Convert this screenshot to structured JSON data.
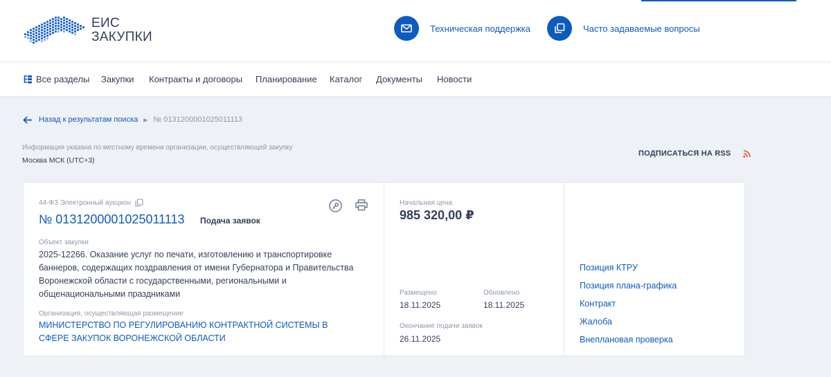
{
  "header": {
    "logo_line1": "ЕИС",
    "logo_line2": "ЗАКУПКИ",
    "support_label": "Техническая поддержка",
    "faq_label": "Часто задаваемые вопросы",
    "accent_color": "#0d5bbf"
  },
  "nav": {
    "items": [
      {
        "label": "Все разделы",
        "icon": "sections-icon"
      },
      {
        "label": "Закупки"
      },
      {
        "label": "Контракты и договоры"
      },
      {
        "label": "Планирование"
      },
      {
        "label": "Каталог"
      },
      {
        "label": "Документы"
      },
      {
        "label": "Новости"
      }
    ]
  },
  "breadcrumb": {
    "back_label": "Назад к результатам поиска",
    "current": "№ 0131200001025011113"
  },
  "timezone": {
    "note": "Информация указана по местному времени организации, осуществляющей закупку",
    "value": "Москва МСК (UTC+3)"
  },
  "rss": {
    "label": "ПОДПИСАТЬСЯ НА RSS",
    "icon": "rss-icon",
    "icon_color": "#e8542e"
  },
  "purchase": {
    "law_type": "44-ФЗ Электронный аукцион",
    "number": "№ 0131200001025011113",
    "status": "Подача заявок",
    "object_label": "Объект закупки",
    "object_text": "2025-12266. Оказание услуг по печати, изготовлению и транспортировке баннеров, содержащих поздравления от имени Губернатора и Правительства Воронежской области с государственными, региональными и общенациональными праздниками",
    "org_label": "Организация, осуществляющая размещение",
    "org_name": "МИНИСТЕРСТВО ПО РЕГУЛИРОВАНИЮ КОНТРАКТНОЙ СИСТЕМЫ В СФЕРЕ ЗАКУПОК ВОРОНЕЖСКОЙ ОБЛАСТИ",
    "price_label": "Начальная цена",
    "price": "985 320,00 ₽",
    "posted_label": "Размещено",
    "posted_date": "18.11.2025",
    "updated_label": "Обновлено",
    "updated_date": "18.11.2025",
    "deadline_label": "Окончание подачи заявок",
    "deadline_date": "26.11.2025"
  },
  "side_links": [
    {
      "label": "Позиция КТРУ"
    },
    {
      "label": "Позиция плана-графика"
    },
    {
      "label": "Контракт"
    },
    {
      "label": "Жалоба"
    },
    {
      "label": "Внеплановая проверка"
    }
  ]
}
